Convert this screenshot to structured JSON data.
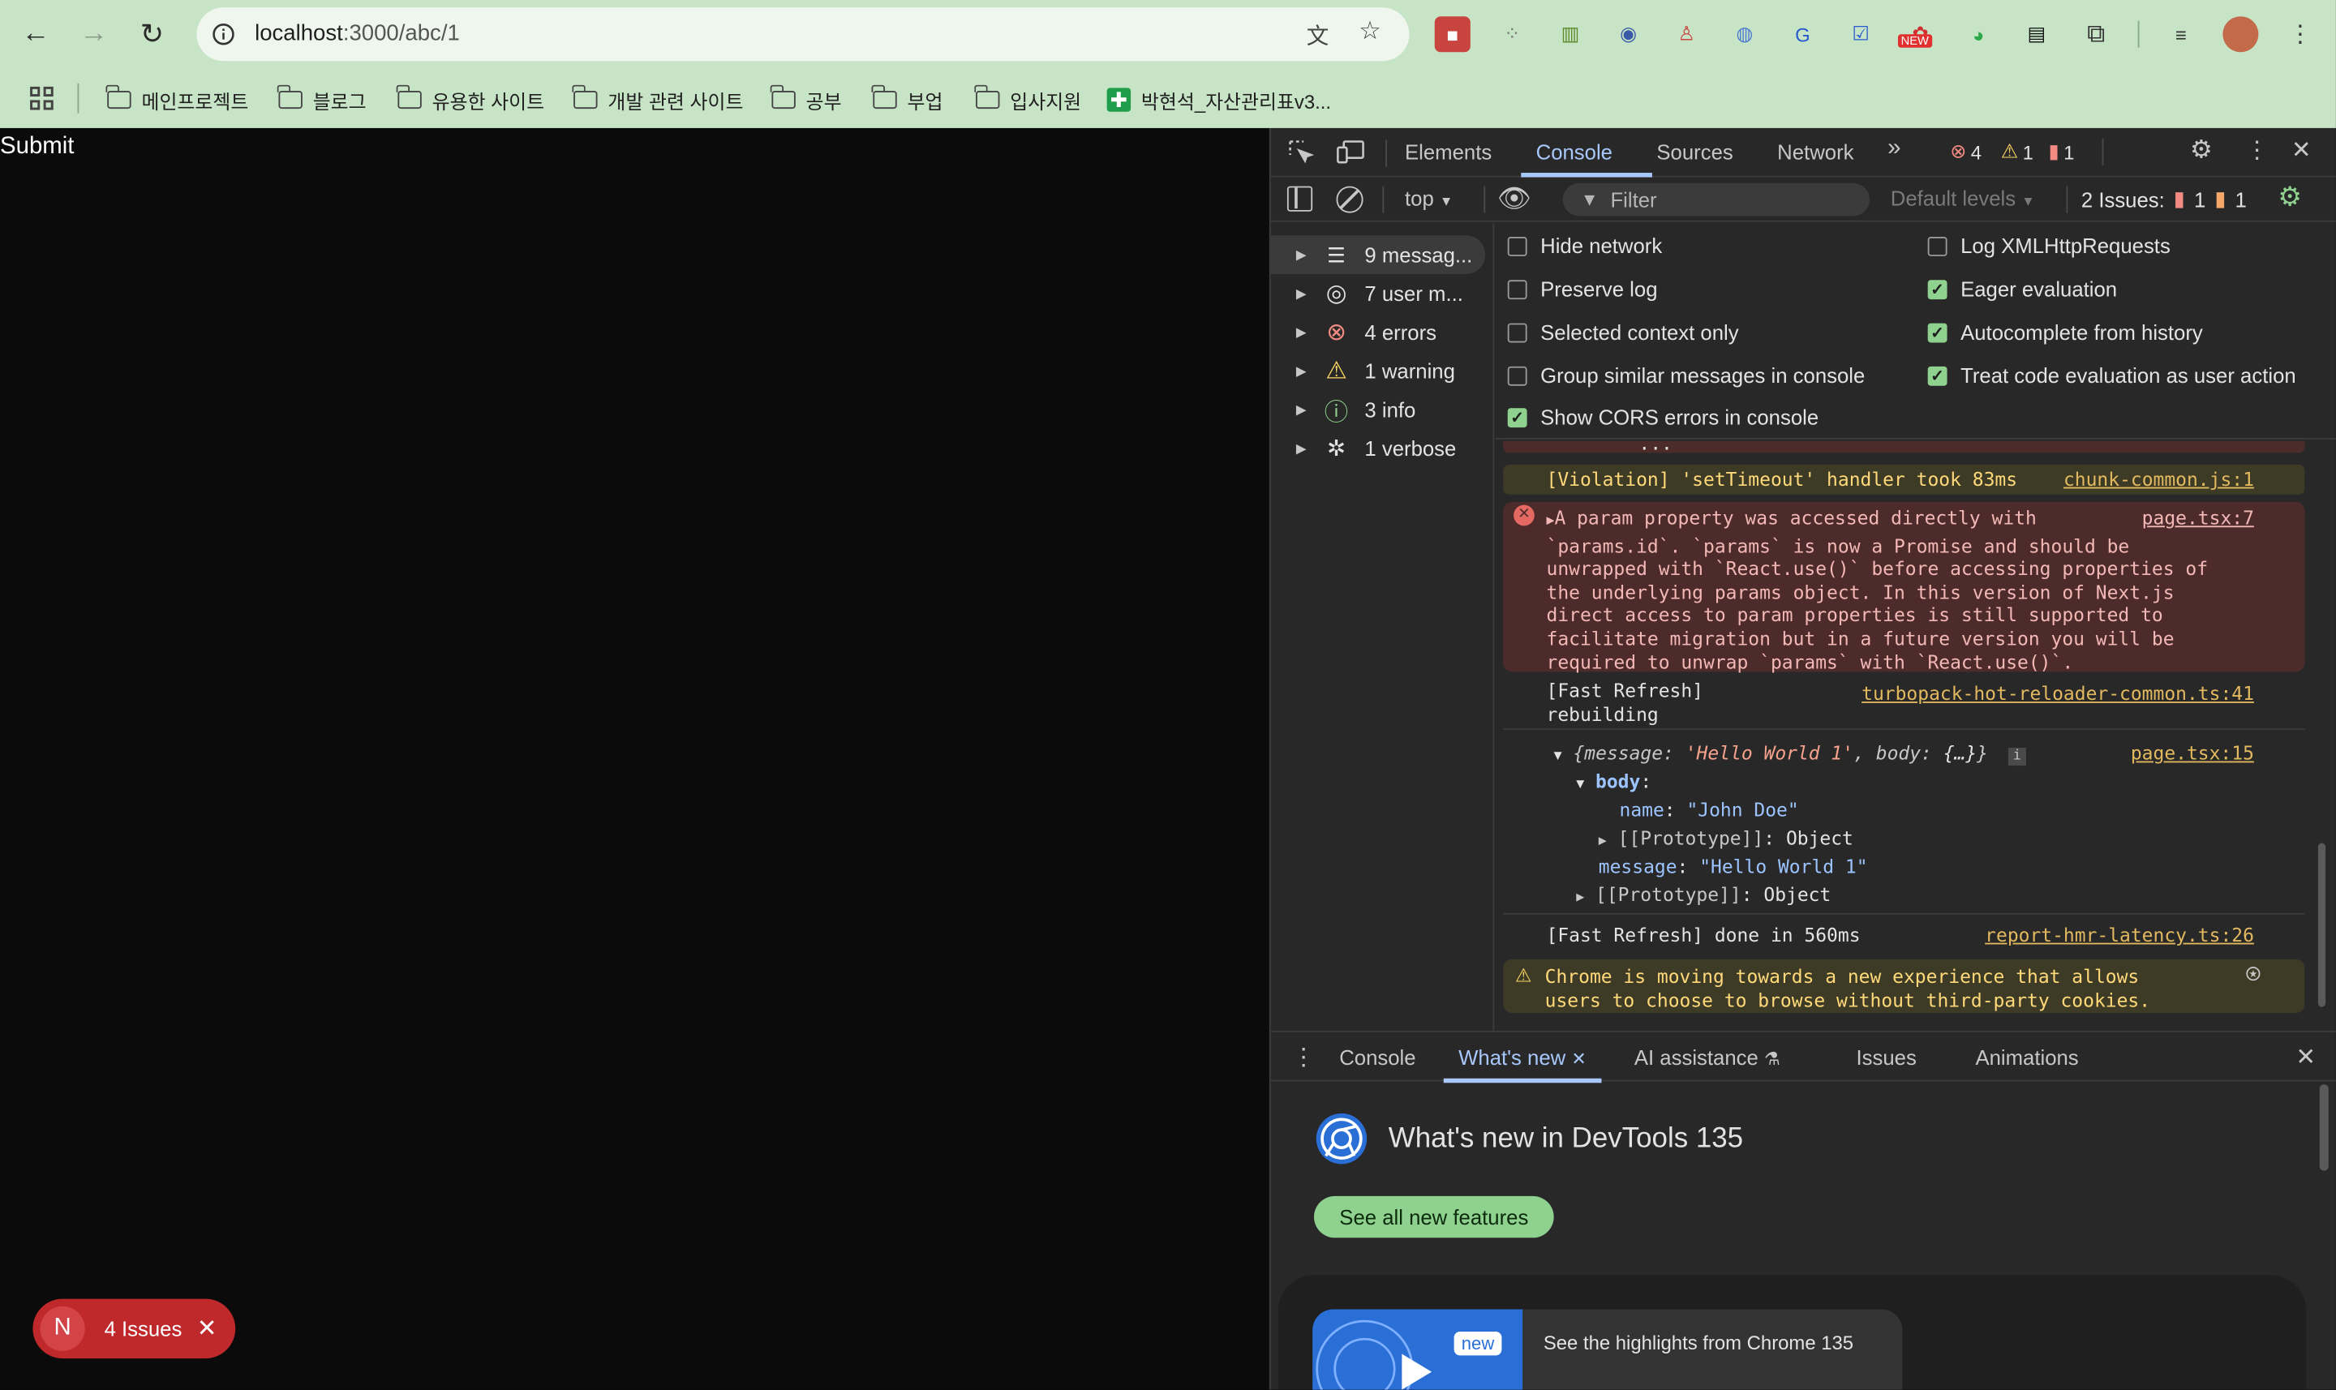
{
  "browser": {
    "url_host": "localhost",
    "url_path": ":3000/abc/1",
    "bookmarks": [
      "메인프로젝트",
      "블로그",
      "유용한 사이트",
      "개발 관련 사이트",
      "공부",
      "부업",
      "입사지원",
      "박현석_자산관리표v3..."
    ],
    "ext_new_badge": "NEW"
  },
  "page": {
    "submit_label": "Submit",
    "issues_badge": {
      "letter": "N",
      "label": "4 Issues"
    }
  },
  "devtools": {
    "tabs": [
      "Elements",
      "Console",
      "Sources",
      "Network"
    ],
    "counts": {
      "errors": "4",
      "warnings": "1",
      "issues": "1"
    },
    "toolbar": {
      "context": "top",
      "filter_placeholder": "Filter",
      "levels": "Default levels",
      "issues_label": "2 Issues:",
      "issue_err": "1",
      "issue_warn": "1"
    },
    "sidebar": [
      {
        "label": "9 messag...",
        "icon": "list-icon"
      },
      {
        "label": "7 user m...",
        "icon": "user-icon"
      },
      {
        "label": "4 errors",
        "icon": "error-icon"
      },
      {
        "label": "1 warning",
        "icon": "warning-icon"
      },
      {
        "label": "3 info",
        "icon": "info-icon"
      },
      {
        "label": "1 verbose",
        "icon": "bug-icon"
      }
    ],
    "settings_left": [
      {
        "label": "Hide network",
        "checked": false
      },
      {
        "label": "Preserve log",
        "checked": false
      },
      {
        "label": "Selected context only",
        "checked": false
      },
      {
        "label": "Group similar messages in console",
        "checked": false
      },
      {
        "label": "Show CORS errors in console",
        "checked": true
      }
    ],
    "settings_right": [
      {
        "label": "Log XMLHttpRequests",
        "checked": false
      },
      {
        "label": "Eager evaluation",
        "checked": true
      },
      {
        "label": "Autocomplete from history",
        "checked": true
      },
      {
        "label": "Treat code evaluation as user action",
        "checked": true
      }
    ],
    "console": {
      "ellipsis": "...",
      "violation": {
        "text": "[Violation] 'setTimeout' handler took 83ms",
        "source": "chunk-common.js:1"
      },
      "error": {
        "lines": [
          "A param property was accessed directly with",
          "`params.id`. `params` is now a Promise and should be",
          "unwrapped with `React.use()` before accessing properties of",
          "the underlying params object. In this version of Next.js",
          "direct access to param properties is still supported to",
          "facilitate migration but in a future version you will be",
          "required to unwrap `params` with `React.use()`."
        ],
        "source": "page.tsx:7"
      },
      "fast_refresh_1": {
        "line1": "[Fast Refresh]",
        "line2": "rebuilding",
        "source": "turbopack-hot-reloader-common.ts:41"
      },
      "object_log": {
        "summary_key1": "message",
        "summary_val1": "'Hello World 1'",
        "summary_key2": "body",
        "summary_val2": "{…}",
        "source": "page.tsx:15",
        "body_key": "body",
        "name_key": "name",
        "name_val": "\"John Doe\"",
        "proto_key": "[[Prototype]]",
        "proto_val": "Object",
        "message_key": "message",
        "message_val": "\"Hello World 1\""
      },
      "fast_refresh_2": {
        "text": "[Fast Refresh] done in 560ms",
        "source": "report-hmr-latency.ts:26"
      },
      "warning": {
        "line1": "Chrome is moving towards a new experience that allows",
        "line2": "users to choose to browse without third-party cookies."
      }
    },
    "drawer_tabs": [
      "Console",
      "What's new",
      "AI assistance",
      "Issues",
      "Animations"
    ],
    "whats_new": {
      "title": "What's new in DevTools 135",
      "button": "See all new features",
      "new_badge": "new",
      "card_text": "See the highlights from Chrome 135"
    }
  }
}
